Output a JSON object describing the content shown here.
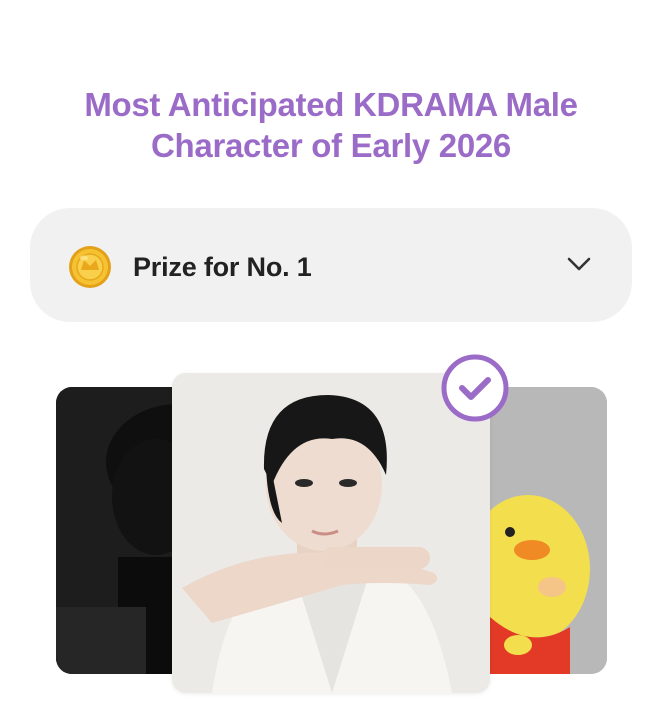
{
  "title": {
    "line1": "Most Anticipated KDRAMA Male",
    "line2": "Character of Early 2026"
  },
  "prize": {
    "label": "Prize for No. 1",
    "icon": "gold-coin-icon",
    "toggle_icon": "chevron-down-icon"
  },
  "carousel": {
    "cards": [
      {
        "position": "left",
        "image": "dark-haired man in black outfit"
      },
      {
        "position": "center",
        "image": "man in white suit posing with hand",
        "selected": true
      },
      {
        "position": "right",
        "image": "yellow duck cartoon character"
      }
    ],
    "selected_icon": "checkmark-circle-icon"
  },
  "colors": {
    "accent": "#9b6bc8",
    "bar_background": "#f1f1f1",
    "coin": "#f2b722"
  }
}
